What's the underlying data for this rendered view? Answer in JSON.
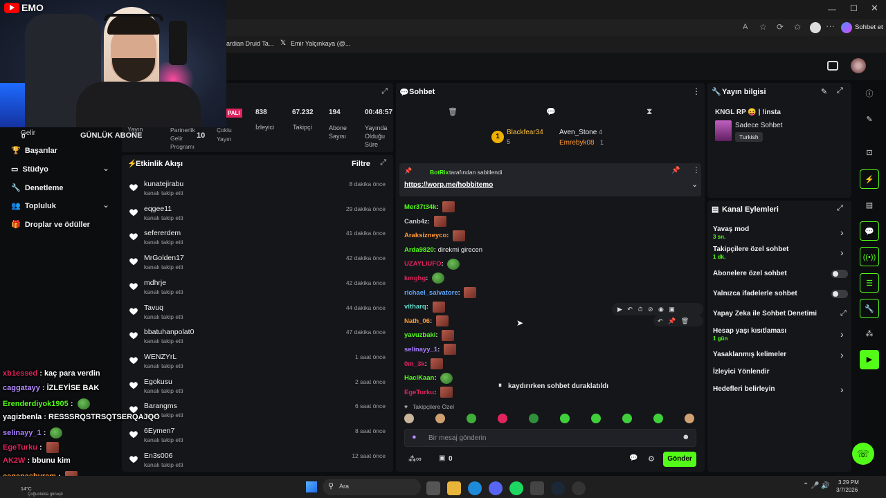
{
  "browser": {
    "tabs": [
      "ardian Druid Ta...",
      "Emir Yalçınkaya (@..."
    ],
    "chat_btn": "Sohbet et"
  },
  "webcam": {
    "brand": "EMO"
  },
  "stream_stats": {
    "badge": "PALI",
    "items": [
      {
        "value": "838",
        "label": "İzleyici"
      },
      {
        "value": "67.232",
        "label": "Takipçi"
      },
      {
        "value": "194",
        "label": "Abone Sayısı"
      },
      {
        "value": "00:48:57",
        "label": "Yayında Olduğu Süre"
      }
    ],
    "left_labels": [
      "Yayın",
      "Partnerlik Gelir Programı",
      "Çoklu Yayın"
    ],
    "gelir": "Gelir",
    "gelir_value": "0",
    "daily_sub_label": "GÜNLÜK ABONE",
    "daily_sub_value": "10"
  },
  "sidebar": {
    "items": [
      {
        "label": "Başarılar",
        "icon": "trophy-icon"
      },
      {
        "label": "Stüdyo",
        "icon": "tv-icon"
      },
      {
        "label": "Denetleme",
        "icon": "wrench-icon"
      },
      {
        "label": "Topluluk",
        "icon": "community-icon"
      },
      {
        "label": "Droplar ve ödüller",
        "icon": "gift-icon"
      }
    ]
  },
  "activity": {
    "title": "Etkinlik Akışı",
    "filter": "Filtre",
    "events": [
      {
        "name": "kunatejirabu",
        "sub": "kanalı takip etti",
        "time": "8 dakika önce"
      },
      {
        "name": "eqgee11",
        "sub": "kanalı takip etti",
        "time": "29 dakika önce"
      },
      {
        "name": "sefererdem",
        "sub": "kanalı takip etti",
        "time": "41 dakika önce"
      },
      {
        "name": "MrGolden17",
        "sub": "kanalı takip etti",
        "time": "42 dakika önce"
      },
      {
        "name": "mdhrje",
        "sub": "kanalı takip etti",
        "time": "42 dakika önce"
      },
      {
        "name": "Tavuq",
        "sub": "kanalı takip etti",
        "time": "44 dakika önce"
      },
      {
        "name": "bbatuhanpolat0",
        "sub": "kanalı takip etti",
        "time": "47 dakika önce"
      },
      {
        "name": "WENZYrL",
        "sub": "kanalı takip etti",
        "time": "1 saat önce"
      },
      {
        "name": "Egokusu",
        "sub": "kanalı takip etti",
        "time": "2 saat önce"
      },
      {
        "name": "Barangms",
        "sub": "kanalı takip etti",
        "time": "6 saat önce"
      },
      {
        "name": "6Eymen7",
        "sub": "kanalı takip etti",
        "time": "8 saat önce"
      },
      {
        "name": "En3s006",
        "sub": "kanalı takip etti",
        "time": "12 saat önce"
      }
    ]
  },
  "chat": {
    "title": "Sohbet",
    "leaders": [
      {
        "name": "Blackfear34",
        "count": "5"
      },
      {
        "name": "Aven_Stone",
        "count": "4"
      },
      {
        "name": "Emrebyk08",
        "count": "1"
      }
    ],
    "pinned_by": "BotRix",
    "pinned_suffix": "tarafından sabitlendi",
    "pinned_link": "https://worp.me/hobbitemo",
    "messages": [
      {
        "user": "Mer37t34k",
        "text": "",
        "emote": "r",
        "color": "#53fc18"
      },
      {
        "user": "Canb4z",
        "text": "",
        "emote": "r",
        "color": "#c8c8c8"
      },
      {
        "user": "Araksizneyco",
        "text": "",
        "emote": "r",
        "color": "#ff9b38"
      },
      {
        "user": "Arda9820",
        "text": "direkmi girecen",
        "emote": "",
        "color": "#53fc18"
      },
      {
        "user": "UZAYLIUFO",
        "text": "",
        "emote": "f",
        "color": "#e0245e"
      },
      {
        "user": "kmghg",
        "text": "",
        "emote": "f",
        "color": "#e0245e"
      },
      {
        "user": "richael_salvatore",
        "text": "",
        "emote": "r",
        "color": "#5fa8ff"
      },
      {
        "user": "vitharq",
        "text": "",
        "emote": "r",
        "color": "#5fd8c8"
      },
      {
        "user": "Nath_06",
        "text": "",
        "emote": "r",
        "color": "#ff9b38"
      },
      {
        "user": "yavuzbaki",
        "text": "",
        "emote": "r",
        "color": "#53fc18"
      },
      {
        "user": "selinayy_1",
        "text": "",
        "emote": "r",
        "color": "#a77dff"
      },
      {
        "user": "0m_3k",
        "text": "",
        "emote": "r",
        "color": "#e0245e"
      },
      {
        "user": "HaciKaan",
        "text": "",
        "emote": "f",
        "color": "#53fc18"
      },
      {
        "user": "EgeTurku",
        "text": "",
        "emote": "r",
        "color": "#e0245e"
      }
    ],
    "paused": "kaydırırken sohbet duraklatıldı",
    "followers_only": "Takipçilere Özel",
    "input_placeholder": "Bir mesaj gönderin",
    "send": "Gönder",
    "points": "0"
  },
  "stream_info": {
    "title": "Yayın bilgisi",
    "stream_title": "KNGL RP 😝 | !insta",
    "category": "Sadece Sohbet",
    "tag": "Turkish"
  },
  "channel_actions": {
    "title": "Kanal Eylemleri",
    "items": [
      {
        "label": "Yavaş mod",
        "sub": "3 sn.",
        "control": "chevron"
      },
      {
        "label": "Takipçilere özel sohbet",
        "sub": "1 dk.",
        "control": "chevron"
      },
      {
        "label": "Abonelere özel sohbet",
        "sub": "",
        "control": "toggle"
      },
      {
        "label": "Yalnızca ifadelerle sohbet",
        "sub": "",
        "control": "toggle"
      },
      {
        "label": "Yapay Zeka ile Sohbet Denetimi",
        "sub": "",
        "control": "external"
      },
      {
        "label": "Hesap yaşı kısıtlaması",
        "sub": "1 gün",
        "control": "chevron"
      },
      {
        "label": "Yasaklanmış kelimeler",
        "sub": "",
        "control": "chevron"
      },
      {
        "label": "İzleyici Yönlendir",
        "sub": "",
        "control": "none"
      },
      {
        "label": "Hedefleri belirleyin",
        "sub": "",
        "control": "chevron"
      }
    ]
  },
  "overlay_chat": [
    {
      "user": "xb1essed",
      "text": "kaç para verdin",
      "color": "#e0245e"
    },
    {
      "user": "caggatayy",
      "text": "İZLEYİSE BAK",
      "color": "#b48cff"
    },
    {
      "user": "Erenderdiyok1905",
      "text": "",
      "color": "#53fc18"
    },
    {
      "user": "yagizbenla",
      "text": "RESSSRQSTRSQTSERQAJQO",
      "color": "#ffffff"
    },
    {
      "user": "selinayy_1",
      "text": "",
      "color": "#a77dff"
    },
    {
      "user": "EgeTurku",
      "text": "",
      "color": "#e0245e"
    },
    {
      "user": "AK2W",
      "text": "bbunu kim",
      "color": "#e0245e"
    },
    {
      "user": "caganasbyram",
      "text": "",
      "color": "#ff9b38"
    }
  ],
  "taskbar": {
    "search": "Ara",
    "time": "3:29 PM",
    "date": "3/7/2026",
    "weather": "14°C",
    "weather_sub": "Çoğunlukla güneşli"
  },
  "colors": {
    "accent": "#53fc18",
    "panel": "#15161a"
  }
}
